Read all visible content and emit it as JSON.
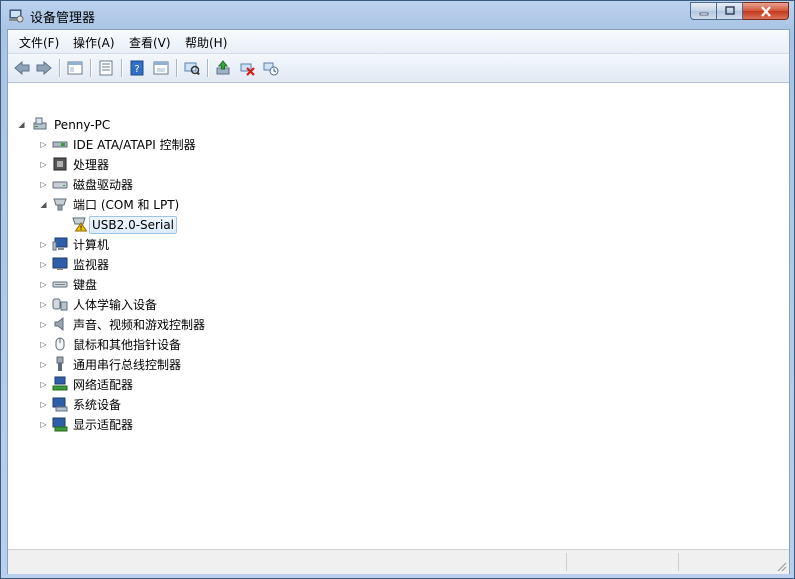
{
  "window": {
    "title": "设备管理器"
  },
  "menu": [
    "文件(F)",
    "操作(A)",
    "查看(V)",
    "帮助(H)"
  ],
  "toolbar": {
    "buttons": [
      "back-icon",
      "forward-icon",
      "tree-view-icon",
      "properties-icon",
      "help-icon",
      "refresh-view-icon",
      "scan-hardware-icon",
      "update-driver-icon",
      "disable-device-icon",
      "uninstall-device-icon"
    ]
  },
  "tree": {
    "root": "Penny-PC",
    "items": [
      "IDE ATA/ATAPI 控制器",
      "处理器",
      "磁盘驱动器",
      "端口 (COM 和 LPT)",
      "USB2.0-Serial",
      "计算机",
      "监视器",
      "键盘",
      "人体学输入设备",
      "声音、视频和游戏控制器",
      "鼠标和其他指针设备",
      "通用串行总线控制器",
      "网络适配器",
      "系统设备",
      "显示适配器"
    ]
  },
  "colors": {
    "selection": "#dcecfb",
    "titlebar": "#bcd3ee",
    "close": "#c3391a"
  }
}
